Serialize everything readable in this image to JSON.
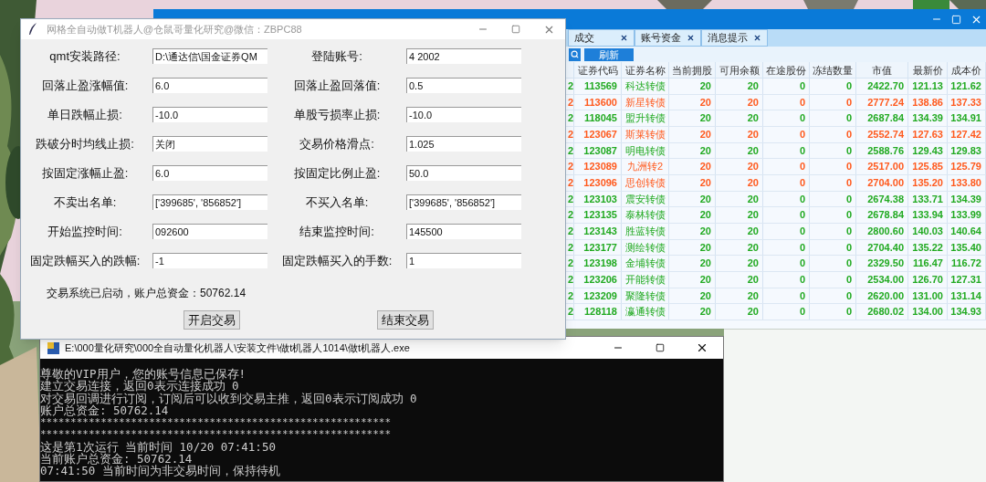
{
  "dialog": {
    "title": "网格全自动做T机器人@仓鼠哥量化研究@微信：ZBPC88",
    "fields": [
      {
        "label": "qmt安装路径:",
        "value": "D:\\通达信\\国金证券QM"
      },
      {
        "label": "登陆账号:",
        "value": "4  2002"
      },
      {
        "label": "回落止盈涨幅值:",
        "value": "6.0"
      },
      {
        "label": "回落止盈回落值:",
        "value": "0.5"
      },
      {
        "label": "单日跌幅止损:",
        "value": "-10.0"
      },
      {
        "label": "单股亏损率止损:",
        "value": "-10.0"
      },
      {
        "label": "跌破分时均线止损:",
        "value": "关闭"
      },
      {
        "label": "交易价格滑点:",
        "value": "1.025"
      },
      {
        "label": "按固定涨幅止盈:",
        "value": "6.0"
      },
      {
        "label": "按固定比例止盈:",
        "value": "50.0"
      },
      {
        "label": "不卖出名单:",
        "value": "['399685', '856852']"
      },
      {
        "label": "不买入名单:",
        "value": "['399685', '856852']"
      },
      {
        "label": "开始监控时间:",
        "value": "092600"
      },
      {
        "label": "结束监控时间:",
        "value": "145500"
      },
      {
        "label": "固定跌幅买入的跌幅:",
        "value": "-1"
      },
      {
        "label": "固定跌幅买入的手数:",
        "value": "1"
      }
    ],
    "status": "交易系统已启动，账户总资金：50762.14",
    "buttons": [
      "开启交易",
      "结束交易"
    ]
  },
  "trading": {
    "tabs": [
      {
        "label": "成交",
        "selected": false
      },
      {
        "label": "账号资金",
        "selected": false
      },
      {
        "label": "消息提示",
        "selected": false
      }
    ],
    "refresh": "刷新",
    "columns": [
      "证券代码",
      "证券名称",
      "当前拥股",
      "可用余额",
      "在途股份",
      "冻结数量",
      "市值",
      "最新价",
      "成本价"
    ],
    "rows": [
      {
        "column_1": "2",
        "color": "#22aa22",
        "cells": [
          "113569",
          "科达转债",
          "20",
          "20",
          "0",
          "0",
          "2422.70",
          "121.13",
          "121.62"
        ]
      },
      {
        "column_1": "2",
        "color": "#ff5a1e",
        "cells": [
          "113600",
          "新星转债",
          "20",
          "20",
          "0",
          "0",
          "2777.24",
          "138.86",
          "137.33"
        ]
      },
      {
        "column_1": "2",
        "color": "#22aa22",
        "cells": [
          "118045",
          "盟升转债",
          "20",
          "20",
          "0",
          "0",
          "2687.84",
          "134.39",
          "134.91"
        ]
      },
      {
        "column_1": "2",
        "color": "#ff5a1e",
        "cells": [
          "123067",
          "斯莱转债",
          "20",
          "20",
          "0",
          "0",
          "2552.74",
          "127.63",
          "127.42"
        ]
      },
      {
        "column_1": "2",
        "color": "#22aa22",
        "cells": [
          "123087",
          "明电转债",
          "20",
          "20",
          "0",
          "0",
          "2588.76",
          "129.43",
          "129.83"
        ]
      },
      {
        "column_1": "2",
        "color": "#ff5a1e",
        "cells": [
          "123089",
          "九洲转2",
          "20",
          "20",
          "0",
          "0",
          "2517.00",
          "125.85",
          "125.79"
        ]
      },
      {
        "column_1": "2",
        "color": "#ff5a1e",
        "cells": [
          "123096",
          "思创转债",
          "20",
          "20",
          "0",
          "0",
          "2704.00",
          "135.20",
          "133.80"
        ]
      },
      {
        "column_1": "2",
        "color": "#22aa22",
        "cells": [
          "123103",
          "震安转债",
          "20",
          "20",
          "0",
          "0",
          "2674.38",
          "133.71",
          "134.39"
        ]
      },
      {
        "column_1": "2",
        "color": "#22aa22",
        "cells": [
          "123135",
          "泰林转债",
          "20",
          "20",
          "0",
          "0",
          "2678.84",
          "133.94",
          "133.99"
        ]
      },
      {
        "column_1": "2",
        "color": "#22aa22",
        "cells": [
          "123143",
          "胜蓝转债",
          "20",
          "20",
          "0",
          "0",
          "2800.60",
          "140.03",
          "140.64"
        ]
      },
      {
        "column_1": "2",
        "color": "#22aa22",
        "cells": [
          "123177",
          "测绘转债",
          "20",
          "20",
          "0",
          "0",
          "2704.40",
          "135.22",
          "135.40"
        ]
      },
      {
        "column_1": "2",
        "color": "#22aa22",
        "cells": [
          "123198",
          "金埔转债",
          "20",
          "20",
          "0",
          "0",
          "2329.50",
          "116.47",
          "116.72"
        ]
      },
      {
        "column_1": "2",
        "color": "#22aa22",
        "cells": [
          "123206",
          "开能转债",
          "20",
          "20",
          "0",
          "0",
          "2534.00",
          "126.70",
          "127.31"
        ]
      },
      {
        "column_1": "2",
        "color": "#22aa22",
        "cells": [
          "123209",
          "聚隆转债",
          "20",
          "20",
          "0",
          "0",
          "2620.00",
          "131.00",
          "131.14"
        ]
      },
      {
        "column_1": "2",
        "color": "#22aa22",
        "cells": [
          "128118",
          "瀛通转债",
          "20",
          "20",
          "0",
          "0",
          "2680.02",
          "134.00",
          "134.93"
        ]
      }
    ]
  },
  "console": {
    "title": "E:\\000量化研究\\000全自动量化机器人\\安装文件\\做t机器人1014\\做t机器人.exe",
    "lines": [
      {
        "kind": "text",
        "text": "尊敬的VIP用户，您的账号信息已保存!"
      },
      {
        "kind": "text",
        "text": "建立交易连接，返回0表示连接成功 0"
      },
      {
        "kind": "text",
        "text": "对交易回调进行订阅，订阅后可以收到交易主推，返回0表示订阅成功 0"
      },
      {
        "kind": "text",
        "text": "账户总资金: 50762.14"
      },
      {
        "kind": "rule",
        "text": "**********************************************************"
      },
      {
        "kind": "rule",
        "text": "**********************************************************"
      },
      {
        "kind": "text",
        "text": "这是第1次运行 当前时间 10/20 07:41:50"
      },
      {
        "kind": "text",
        "text": "当前账户总资金:  50762.14"
      },
      {
        "kind": "text",
        "text": "07:41:50 当前时间为非交易时间，保持待机"
      }
    ]
  }
}
